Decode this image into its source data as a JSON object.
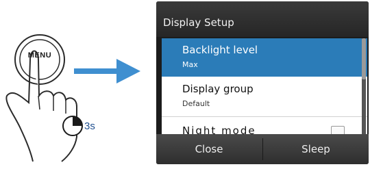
{
  "illustration": {
    "menu_key_label": "MENU",
    "hold_duration": "3s"
  },
  "screen": {
    "title": "Display Setup",
    "items": [
      {
        "label": "Backlight level",
        "value": "Max",
        "selected": true
      },
      {
        "label": "Display group",
        "value": "Default",
        "selected": false
      },
      {
        "label": "Night mode",
        "value": "",
        "selected": false
      }
    ],
    "buttons": {
      "close_label": "Close",
      "sleep_label": "Sleep"
    },
    "colors": {
      "selection": "#2b7cb8",
      "arrow": "#3f8fd0"
    }
  }
}
